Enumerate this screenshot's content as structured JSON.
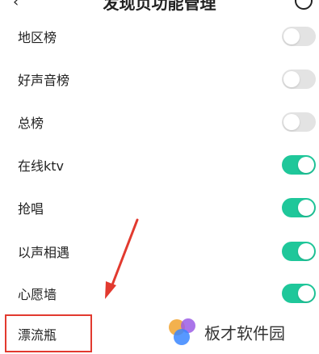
{
  "header": {
    "title": "发现页功能管理",
    "back_icon": "back-arrow-icon",
    "help_icon": "help-circle-icon"
  },
  "settings": [
    {
      "label": "地区榜",
      "enabled": false
    },
    {
      "label": "好声音榜",
      "enabled": false
    },
    {
      "label": "总榜",
      "enabled": false
    },
    {
      "label": "在线ktv",
      "enabled": true
    },
    {
      "label": "抢唱",
      "enabled": true
    },
    {
      "label": "以声相遇",
      "enabled": true
    },
    {
      "label": "心愿墙",
      "enabled": true
    },
    {
      "label": "漂流瓶",
      "enabled": null
    }
  ],
  "colors": {
    "toggle_on": "#1fc79a",
    "toggle_off": "#e3e3e3",
    "annotation": "#e23a2f"
  },
  "watermark": {
    "text": "板才软件园"
  }
}
